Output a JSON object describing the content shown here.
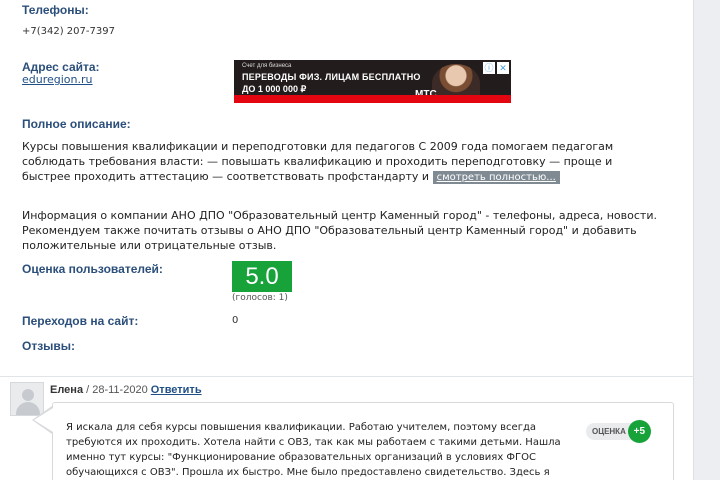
{
  "phones": {
    "label": "Телефоны:",
    "value": "+7(342) 207-7397"
  },
  "website": {
    "label": "Адрес сайта:",
    "value": "eduregion.ru"
  },
  "ad": {
    "small_text": "Счет для бизнеса",
    "line1": "ПЕРЕВОДЫ ФИЗ. ЛИЦАМ БЕСПЛАТНО",
    "line2": "ДО 1 000 000 ₽",
    "brand": "МТС",
    "info_icon": "ⓘ",
    "close_icon": "✕",
    "brand_color": "#e30611"
  },
  "description": {
    "label": "Полное описание:",
    "text": "Курсы повышения квалификации и переподготовки для педагогов С 2009 года помогаем педагогам соблюдать требования власти: — повышать квалификацию и проходить переподготовку — проще и быстрее проходить аттестацию — соответствовать профстандарту и",
    "more_label": "смотреть полностью..."
  },
  "info_text": "Информация о компании АНО ДПО \"Образовательный центр Каменный город\" - телефоны, адреса, новости. Рекомендуем также почитать отзывы о АНО ДПО \"Образовательный центр Каменный город\" и добавить положительные или отрицательные отзыв.",
  "rating": {
    "label": "Оценка пользователей:",
    "score": "5.0",
    "votes": "(голосов: 1)",
    "color": "#17a23a"
  },
  "clicks": {
    "label": "Переходов на сайт:",
    "value": "0"
  },
  "reviews": {
    "label": "Отзывы:",
    "items": [
      {
        "author": "Елена",
        "separator": " / ",
        "date": "28-11-2020",
        "reply_label": "Ответить",
        "text": "Я искала для себя курсы повышения квалификации. Работаю учителем, поэтому всегда требуются их проходить. Хотела найти с ОВЗ, так как мы работаем с такими детьми. Нашла именно тут курсы: \"Функционирование образовательных организаций в условиях ФГОС обучающихся с ОВЗ\". Прошла их быстро. Мне было предоставлено свидетельство. Здесь я нашла много полезной",
        "vote_label": "ОЦЕНКА",
        "vote_value": "+5"
      }
    ]
  }
}
